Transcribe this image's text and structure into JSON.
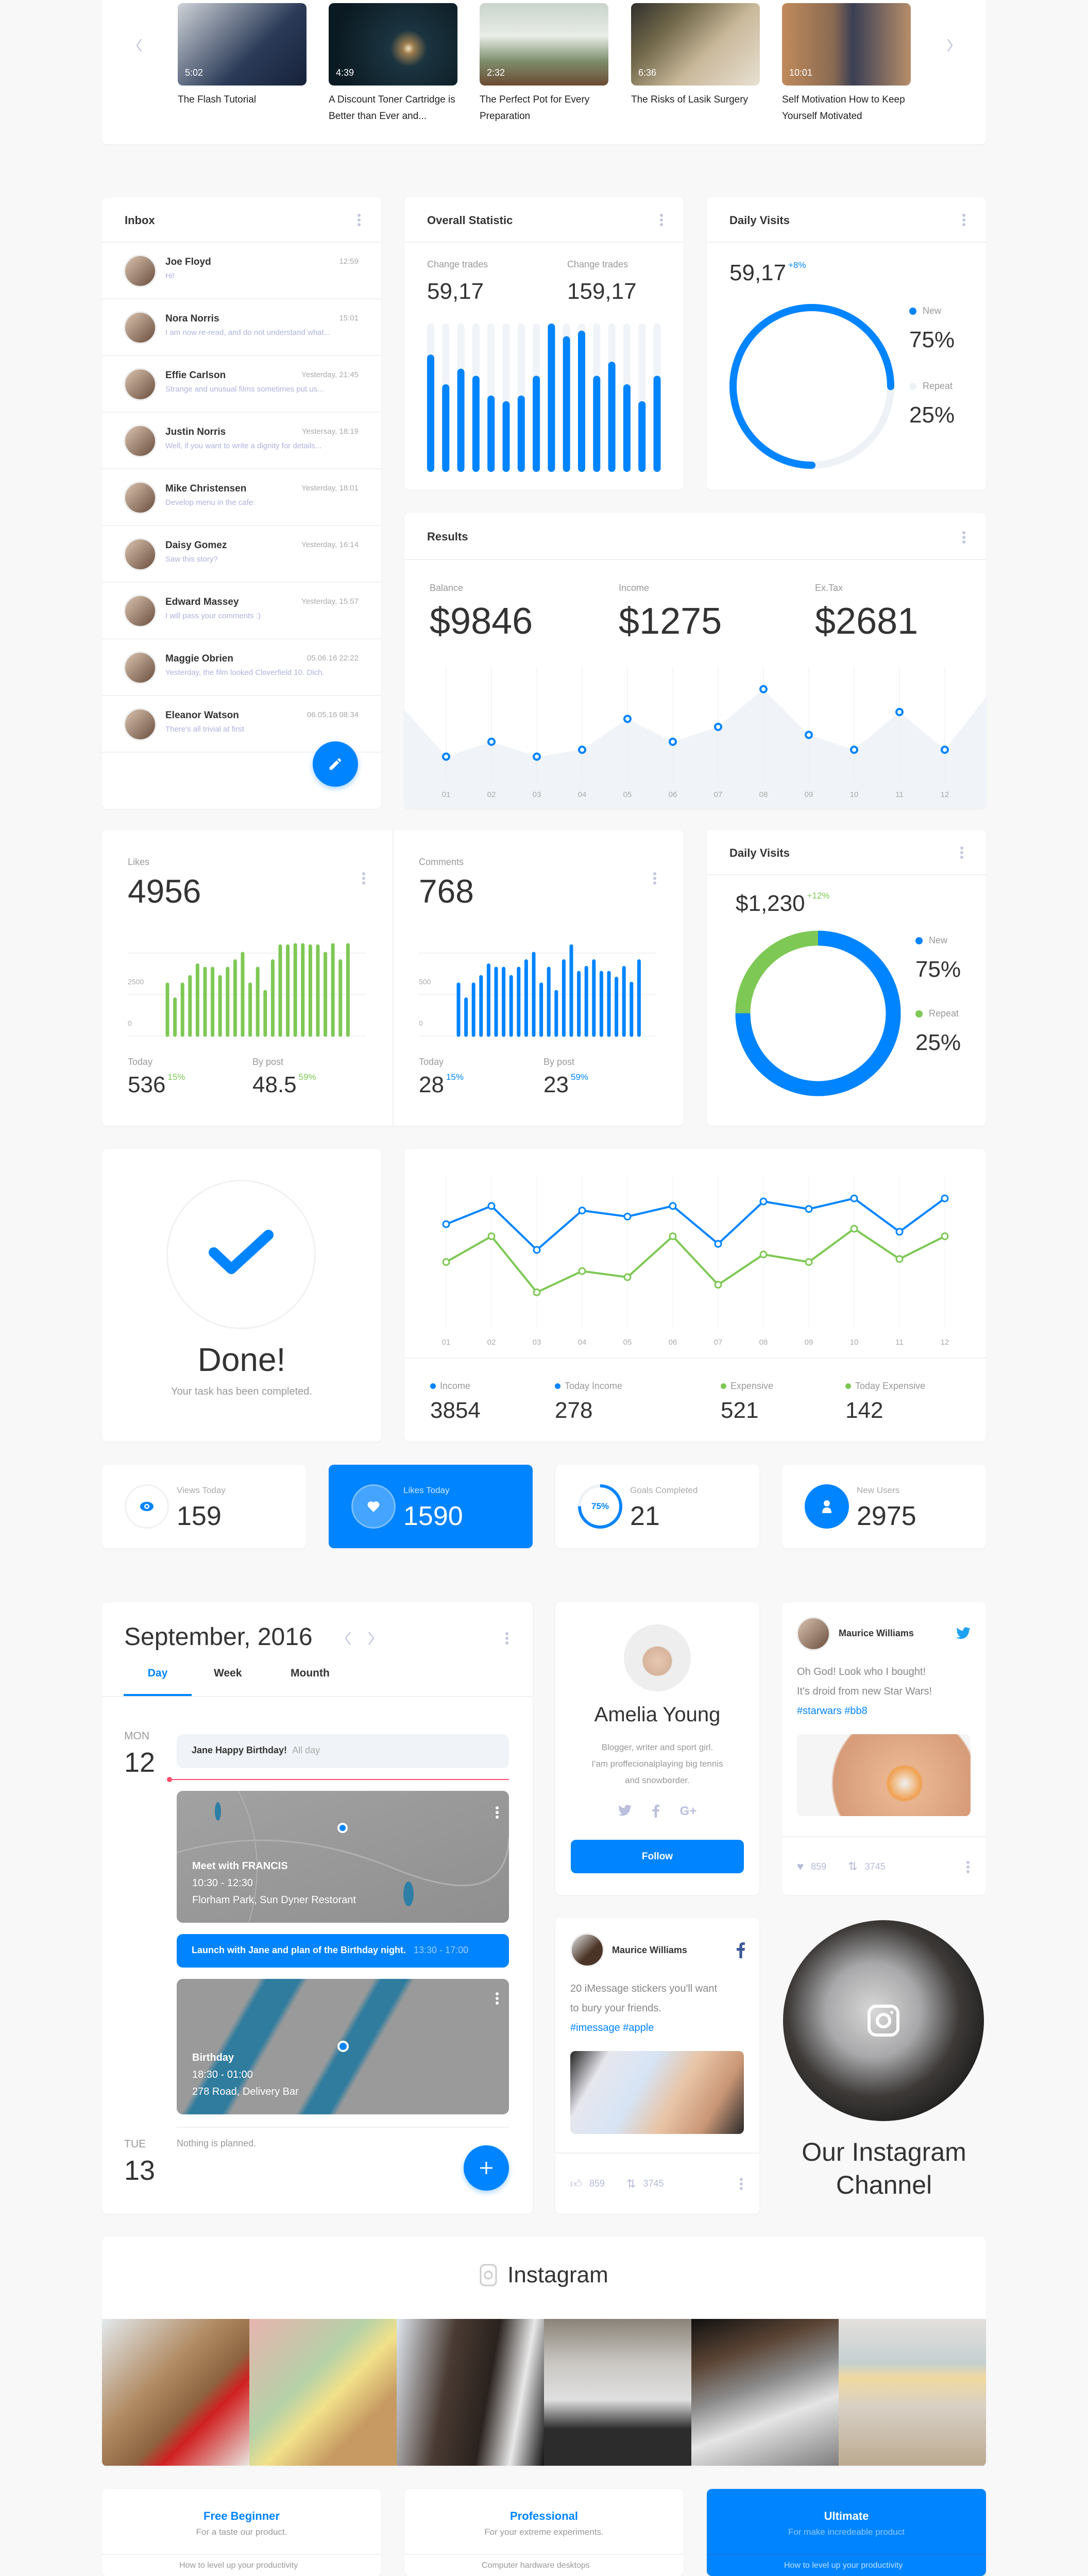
{
  "colors": {
    "accent": "#0084ff",
    "green": "#7ec855",
    "track": "#eef2f7",
    "alert": "#ff4d6d"
  },
  "carousel": {
    "prev_icon": "chevron-left-icon",
    "next_icon": "chevron-right-icon",
    "items": [
      {
        "duration": "5:02",
        "title": "The Flash Tutorial"
      },
      {
        "duration": "4:39",
        "title": "A Discount Toner Cartridge is Better than Ever and..."
      },
      {
        "duration": "2:32",
        "title": "The Perfect Pot for Every Preparation"
      },
      {
        "duration": "6:36",
        "title": "The Risks of Lasik Surgery"
      },
      {
        "duration": "10:01",
        "title": "Self Motivation How to Keep Yourself Motivated"
      }
    ]
  },
  "inbox": {
    "title": "Inbox",
    "messages": [
      {
        "name": "Joe Floyd",
        "time": "12:59",
        "preview": "Hi!"
      },
      {
        "name": "Nora Norris",
        "time": "15:01",
        "preview": "I am now re-read, and do not understand what..."
      },
      {
        "name": "Effie Carlson",
        "time": "Yesterday, 21:45",
        "preview": "Strange and unusual films sometimes put us..."
      },
      {
        "name": "Justin Norris",
        "time": "Yestersay, 18:19",
        "preview": "Well, if you want to write a dignity for details..."
      },
      {
        "name": "Mike Christensen",
        "time": "Yesterday, 18:01",
        "preview": "Develop menu in the cafe:"
      },
      {
        "name": "Daisy Gomez",
        "time": "Yesterday, 16:14",
        "preview": "Saw this story?"
      },
      {
        "name": "Edward Massey",
        "time": "Yesterday, 15:57",
        "preview": "I will pass your comments :)"
      },
      {
        "name": "Maggie Obrien",
        "time": "05.06.16 22:22",
        "preview": "Yesterday, the film looked Cloverfield 10. Dich."
      },
      {
        "name": "Eleanor Watson",
        "time": "06.05.16 08:34",
        "preview": "There's all trivial at first"
      }
    ]
  },
  "overall": {
    "title": "Overall Statistic",
    "stats": [
      {
        "label": "Change trades",
        "value": "59,17"
      },
      {
        "label": "Change trades",
        "value": "159,17"
      }
    ]
  },
  "daily_visits_1": {
    "title": "Daily Visits",
    "value": "59,17",
    "change": "+8%",
    "legend": [
      {
        "label": "New",
        "value": "75%"
      },
      {
        "label": "Repeat",
        "value": "25%"
      }
    ]
  },
  "results": {
    "title": "Results",
    "stats": [
      {
        "label": "Balance",
        "value": "$9846"
      },
      {
        "label": "Income",
        "value": "$1275"
      },
      {
        "label": "Ex.Tax",
        "value": "$2681"
      }
    ]
  },
  "likes": {
    "label": "Likes",
    "value": "4956",
    "today_label": "Today",
    "today_value": "536",
    "today_change": "15%",
    "bypost_label": "By post",
    "bypost_value": "48.5",
    "bypost_change": "59%"
  },
  "comments": {
    "label": "Comments",
    "value": "768",
    "today_label": "Today",
    "today_value": "28",
    "today_change": "15%",
    "bypost_label": "By post",
    "bypost_value": "23",
    "bypost_change": "59%"
  },
  "daily_visits_2": {
    "title": "Daily Visits",
    "value": "$1,230",
    "change": "+12%",
    "legend": [
      {
        "label": "New",
        "value": "75%"
      },
      {
        "label": "Repeat",
        "value": "25%"
      }
    ]
  },
  "done": {
    "title": "Done!",
    "subtitle": "Your task has been completed."
  },
  "income_summary": [
    {
      "label": "Income",
      "value": "3854",
      "color": "#0084ff"
    },
    {
      "label": "Today Income",
      "value": "278",
      "color": "#0084ff"
    },
    {
      "label": "Expensive",
      "value": "521",
      "color": "#7ec855"
    },
    {
      "label": "Today Expensive",
      "value": "142",
      "color": "#7ec855"
    }
  ],
  "stats_cards": [
    {
      "label": "Views Today",
      "value": "159",
      "icon": "eye-icon"
    },
    {
      "label": "Likes Today",
      "value": "1590",
      "icon": "heart-icon",
      "active": true
    },
    {
      "label": "Goals Completed",
      "value": "21",
      "icon": "progress-ring",
      "progress": "75%"
    },
    {
      "label": "New Users",
      "value": "2975",
      "icon": "user-icon"
    }
  ],
  "calendar": {
    "title": "September, 2016",
    "tabs": [
      "Day",
      "Week",
      "Mounth"
    ],
    "active_tab": "Day",
    "day1": {
      "weekday": "MON",
      "day": "12"
    },
    "allday_event": {
      "title": "Jane Happy Birthday!",
      "time": "All day"
    },
    "event1": {
      "title": "Meet with FRANCIS",
      "time": "10:30 - 12:30",
      "place": "Florham Park, Sun Dyner Restorant"
    },
    "event2": {
      "title": "Launch with Jane and plan of the Birthday night.",
      "time": "13:30 - 17:00"
    },
    "event3": {
      "title": "Birthday",
      "time": "18:30 - 01:00",
      "place": "278 Road, Delivery Bar"
    },
    "day2": {
      "weekday": "TUE",
      "day": "13",
      "empty": "Nothing is planned."
    }
  },
  "profile": {
    "name": "Amelia Young",
    "bio": [
      "Blogger, writer and sport girl.",
      "I'am proffecionalplaying big tennis",
      "and snowborder."
    ],
    "follow_label": "Follow",
    "socials": [
      "twitter-icon",
      "facebook-icon",
      "google-plus-icon"
    ]
  },
  "tweet": {
    "author": "Maurice Williams",
    "lines": [
      "Oh God! Look who I bought!",
      "It's droid from new Star Wars!"
    ],
    "tags": "#starwars #bb8",
    "likes": "859",
    "retweets": "3745"
  },
  "fb_post": {
    "author": "Maurice Williams",
    "lines": [
      "20 iMessage stickers you'll want",
      "to bury your friends."
    ],
    "tags": "#imessage #apple",
    "likes": "859",
    "shares": "3745"
  },
  "instagram_channel": {
    "line1": "Our Instagram",
    "line2": "Channel"
  },
  "instagram": {
    "title": "Instagram"
  },
  "pricing": [
    {
      "title": "Free Beginner",
      "subtitle": "For a taste our product.",
      "feature": "How to level up your productivity"
    },
    {
      "title": "Professional",
      "subtitle": "For your extreme experiments.",
      "feature": "Computer hardware desktops"
    },
    {
      "title": "Ultimate",
      "subtitle": "For make incredeable product",
      "feature": "How to level up your productivity",
      "active": true
    }
  ],
  "chart_data": [
    {
      "id": "overall",
      "type": "bar",
      "values_percent": [
        78,
        57,
        68,
        63,
        49,
        45,
        49,
        63,
        100,
        91,
        95,
        63,
        73,
        57,
        45,
        63
      ],
      "ylim": [
        0,
        100
      ]
    },
    {
      "id": "results",
      "type": "area",
      "categories": [
        "01",
        "02",
        "03",
        "04",
        "05",
        "06",
        "07",
        "08",
        "09",
        "10",
        "11",
        "12"
      ],
      "values": [
        20,
        33,
        20,
        26,
        53,
        33,
        46,
        79,
        39,
        26,
        59,
        26
      ]
    },
    {
      "id": "likes",
      "type": "bar",
      "ylim": [
        0,
        5000
      ],
      "yticks": [
        "0",
        "2500",
        "5000"
      ],
      "values": [
        3150,
        2250,
        3150,
        3600,
        4300,
        4100,
        4100,
        3600,
        4100,
        4550,
        5000,
        3150,
        4100,
        2700,
        4550,
        5450,
        5450,
        5900,
        6400,
        5450,
        5450,
        5000,
        5900,
        4550,
        6450
      ]
    },
    {
      "id": "comments",
      "type": "bar",
      "ylim": [
        0,
        1000
      ],
      "yticks": [
        "0",
        "500",
        "100"
      ],
      "values": [
        630,
        450,
        630,
        720,
        860,
        820,
        820,
        720,
        820,
        910,
        1000,
        630,
        820,
        540,
        910,
        1090,
        770,
        830,
        910,
        770,
        770,
        700,
        830,
        640,
        910
      ]
    },
    {
      "id": "daily_visits_1",
      "type": "pie",
      "donut": true,
      "slices": [
        {
          "label": "New",
          "value": 75
        },
        {
          "label": "Repeat",
          "value": 25
        }
      ]
    },
    {
      "id": "daily_visits_2",
      "type": "pie",
      "donut": true,
      "slices": [
        {
          "label": "New",
          "value": 75
        },
        {
          "label": "Repeat",
          "value": 25
        }
      ]
    },
    {
      "id": "income_lines",
      "type": "line",
      "categories": [
        "01",
        "02",
        "03",
        "04",
        "05",
        "06",
        "07",
        "08",
        "09",
        "10",
        "11",
        "12"
      ],
      "series": [
        {
          "name": "Income",
          "values": [
            68,
            80,
            51,
            77,
            73,
            80,
            55,
            83,
            78,
            85,
            63,
            85
          ]
        },
        {
          "name": "Expensive",
          "values": [
            43,
            60,
            23,
            37,
            33,
            60,
            28,
            48,
            43,
            65,
            45,
            60
          ]
        }
      ]
    }
  ]
}
